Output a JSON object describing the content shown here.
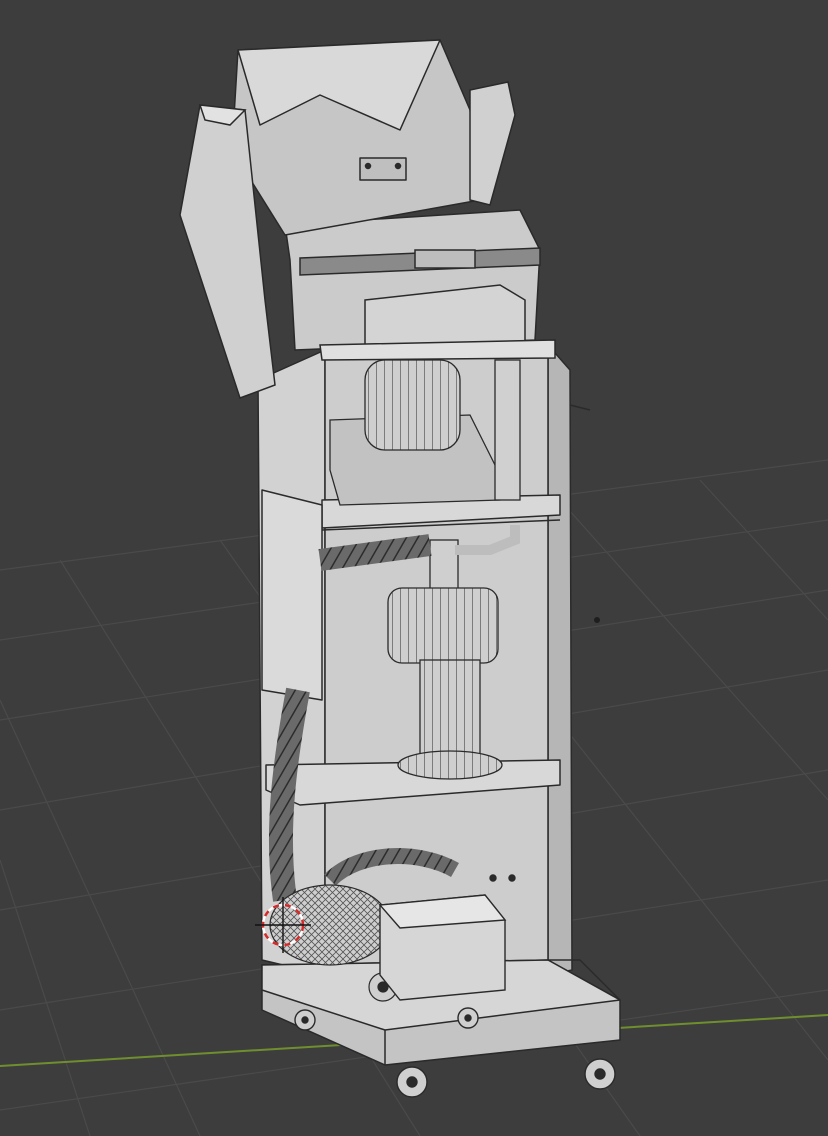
{
  "viewport": {
    "background": "#3d3d3d",
    "grid_color": "#4a4a4a",
    "x_axis_color": "#6f8f2e",
    "wire_color": "#2a2a2a",
    "mesh_fill": "#c8c8c8",
    "mesh_fill_dark": "#a9a9a9",
    "mesh_fill_light": "#dcdcdc",
    "cursor_color": "#d42a2a"
  },
  "scene_object": {
    "icon": "3d-cursor-icon",
    "parts": [
      "hopper",
      "lid-arm-left",
      "lid-arm-right",
      "upper-bin",
      "blower-motor-top",
      "blower-motor-middle",
      "vacuum-hose",
      "handheld-vacuum",
      "filter-box",
      "cabinet-frame",
      "caster-wheels"
    ]
  }
}
